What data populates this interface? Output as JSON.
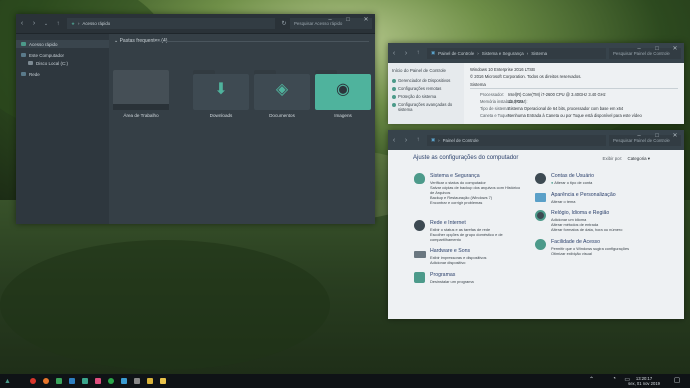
{
  "explorer": {
    "address": "Acesso rápido",
    "search_placeholder": "Pesquisar Acesso rápido",
    "nav": [
      {
        "label": "Acesso rápido",
        "icon": "star-icon"
      },
      {
        "label": "Este Computador",
        "icon": "computer-icon"
      },
      {
        "label": "Disco Local (C:)",
        "icon": "drive-icon"
      },
      {
        "label": "Rede",
        "icon": "network-icon"
      }
    ],
    "group_title": "Pastas frequentes (4)",
    "folders": [
      {
        "label": "Área de Trabalho",
        "icon": "desktop-folder-icon"
      },
      {
        "label": "Downloads",
        "icon": "download-folder-icon"
      },
      {
        "label": "Documentos",
        "icon": "documents-folder-icon"
      },
      {
        "label": "Imagens",
        "icon": "pictures-folder-icon"
      }
    ]
  },
  "system": {
    "breadcrumb": [
      "Painel de Controle",
      "Sistema e Segurança",
      "Sistema"
    ],
    "search_placeholder": "Pesquisar Painel de Controle",
    "side_head": "Início do Painel de Controle",
    "side_items": [
      "Gerenciador de Dispositivos",
      "Configurações remotas",
      "Proteção do sistema",
      "Configurações avançadas do sistema"
    ],
    "edition": "Windows 10 Enterprise 2016 LTSB",
    "copyright": "© 2016 Microsoft Corporation. Todos os direitos reservados.",
    "section": "Sistema",
    "rows": [
      {
        "k": "Processador:",
        "v": "Intel(R) Core(TM) i7-2600 CPU @ 3.40GHz   3.40 GHz"
      },
      {
        "k": "Memória instalada (RAM):",
        "v": "12,0 GB"
      },
      {
        "k": "Tipo de sistema:",
        "v": "Sistema Operacional de 64 bits, processador com base em x64"
      },
      {
        "k": "Caneta e Toque:",
        "v": "Nenhuma Entrada à Caneta ou por Toque está disponível para este vídeo"
      }
    ]
  },
  "cpanel": {
    "address": "Painel de Controle",
    "search_placeholder": "Pesquisar Painel de Controle",
    "title": "Ajuste as configurações do computador",
    "view_by_label": "Exibir por:",
    "view_by_value": "Categoria ▾",
    "categories": [
      {
        "h": "Sistema e Segurança",
        "icon": "shield-icon",
        "links": [
          "Verificar o status do computador",
          "Salvar cópias de backup dos arquivos com Histórico de Arquivos",
          "Backup e Restauração (Windows 7)",
          "Encontrar e corrigir problemas"
        ]
      },
      {
        "h": "Rede e Internet",
        "icon": "network-globe-icon",
        "links": [
          "Exibir o status e as tarefas de rede",
          "Escolher opções de grupo doméstico e de compartilhamento"
        ]
      },
      {
        "h": "Hardware e Sons",
        "icon": "printer-icon",
        "links": [
          "Exibir impressoras e dispositivos",
          "Adicionar dispositivo"
        ]
      },
      {
        "h": "Programas",
        "icon": "programs-icon",
        "links": [
          "Desinstalar um programa"
        ]
      },
      {
        "h": "Contas de Usuário",
        "icon": "users-icon",
        "links": [
          "Alterar o tipo de conta"
        ]
      },
      {
        "h": "Aparência e Personalização",
        "icon": "palette-icon",
        "links": [
          "Alterar o tema"
        ]
      },
      {
        "h": "Relógio, Idioma e Região",
        "icon": "clock-globe-icon",
        "links": [
          "Adicionar um idioma",
          "Alterar métodos de entrada",
          "Alterar formatos de data, hora ou número"
        ]
      },
      {
        "h": "Facilidade de Acesso",
        "icon": "accessibility-icon",
        "links": [
          "Permitir que o Windows sugira configurações",
          "Otimizar exibição visual"
        ]
      }
    ]
  },
  "taskbar": {
    "time": "13:20:17",
    "date": "sex, 01 nov 2019",
    "apps": [
      {
        "name": "start-icon",
        "color": "#cfd6db"
      },
      {
        "name": "record-icon",
        "color": "#d9362b"
      },
      {
        "name": "firefox-icon",
        "color": "#e8762b"
      },
      {
        "name": "store-icon",
        "color": "#3aa55c"
      },
      {
        "name": "photoshop-icon",
        "color": "#2d7fc1"
      },
      {
        "name": "audition-icon",
        "color": "#3aa58c"
      },
      {
        "name": "audio-icon",
        "color": "#e04f7f"
      },
      {
        "name": "spotify-icon",
        "color": "#2aa84a"
      },
      {
        "name": "media-icon",
        "color": "#3a9bd1"
      },
      {
        "name": "terminal-icon",
        "color": "#888888"
      },
      {
        "name": "files-icon",
        "color": "#d9b43a"
      },
      {
        "name": "explorer-icon",
        "color": "#e8c24a"
      }
    ]
  }
}
